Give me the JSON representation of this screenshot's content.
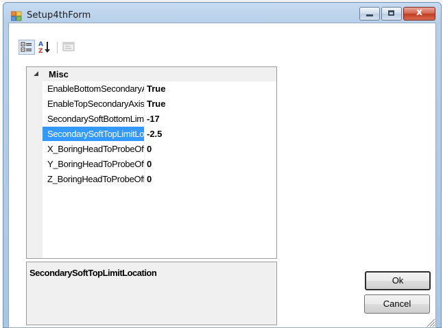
{
  "window": {
    "title": "Setup4thForm",
    "controls": {
      "close_glyph": "x"
    }
  },
  "toolbar": {
    "icons": [
      "categorized-icon",
      "alphabetical-icon",
      "property-pages-icon"
    ]
  },
  "property_grid": {
    "category": "Misc",
    "properties": [
      {
        "name": "EnableBottomSecondaryAxis",
        "value": "True"
      },
      {
        "name": "EnableTopSecondaryAxis",
        "value": "True"
      },
      {
        "name": "SecondarySoftBottomLimitLocation",
        "value": "-17"
      },
      {
        "name": "SecondarySoftTopLimitLocation",
        "value": "-2.5",
        "selected": true
      },
      {
        "name": "X_BoringHeadToProbeOffset",
        "value": "0"
      },
      {
        "name": "Y_BoringHeadToProbeOffset",
        "value": "0"
      },
      {
        "name": "Z_BoringHeadToProbeOffset",
        "value": "0"
      }
    ]
  },
  "description": {
    "title": "SecondarySoftTopLimitLocation"
  },
  "buttons": {
    "ok": "Ok",
    "cancel": "Cancel"
  },
  "colors": {
    "selection": "#3399ff",
    "titlebar": "#b7cfe9",
    "close_button": "#c23a22"
  }
}
